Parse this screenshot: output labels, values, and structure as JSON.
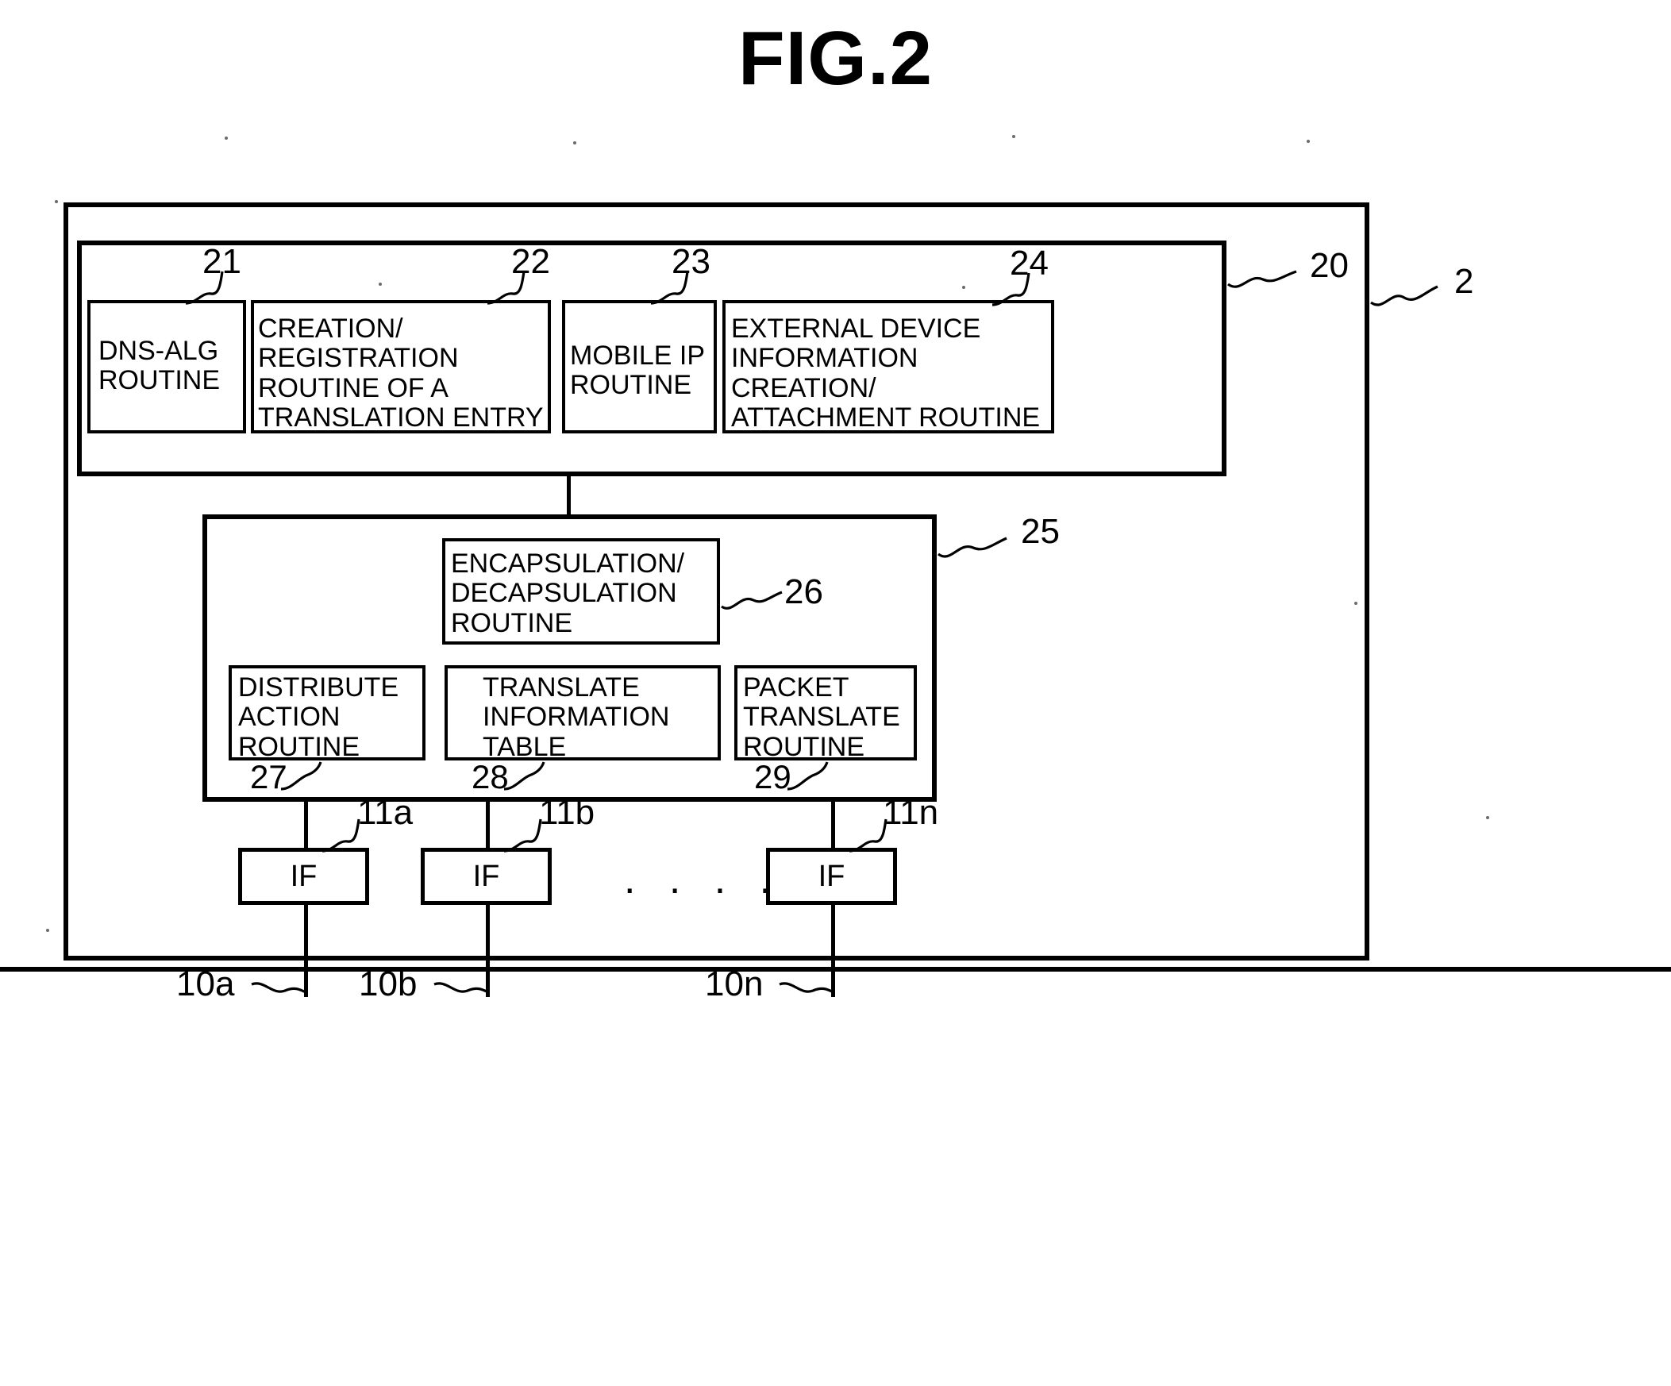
{
  "figure": {
    "title": "FIG.2",
    "refs": {
      "device": "2",
      "upper_block": "20",
      "lower_block": "25"
    }
  },
  "upper_block": {
    "ref": "20",
    "modules": [
      {
        "ref": "21",
        "label": "DNS-ALG\nROUTINE"
      },
      {
        "ref": "22",
        "label": "CREATION/\nREGISTRATION\nROUTINE OF A\nTRANSLATION ENTRY"
      },
      {
        "ref": "23",
        "label": "MOBILE IP\nROUTINE"
      },
      {
        "ref": "24",
        "label": "EXTERNAL DEVICE\nINFORMATION\nCREATION/\nATTACHMENT ROUTINE"
      }
    ]
  },
  "lower_block": {
    "ref": "25",
    "encapsulation": {
      "ref": "26",
      "label": "ENCAPSULATION/\nDECAPSULATION\nROUTINE"
    },
    "modules": [
      {
        "ref": "27",
        "label": "DISTRIBUTE\nACTION\nROUTINE"
      },
      {
        "ref": "28",
        "label": "TRANSLATE\nINFORMATION\nTABLE"
      },
      {
        "ref": "29",
        "label": "PACKET\nTRANSLATE\nROUTINE"
      }
    ]
  },
  "interfaces": [
    {
      "ref": "11a",
      "label": "IF",
      "link_ref": "10a"
    },
    {
      "ref": "11b",
      "label": "IF",
      "link_ref": "10b"
    },
    {
      "ref": "11n",
      "label": "IF",
      "link_ref": "10n"
    }
  ],
  "ellipsis": ". . . .",
  "colors": {
    "ink": "#000000",
    "paper": "#ffffff"
  }
}
